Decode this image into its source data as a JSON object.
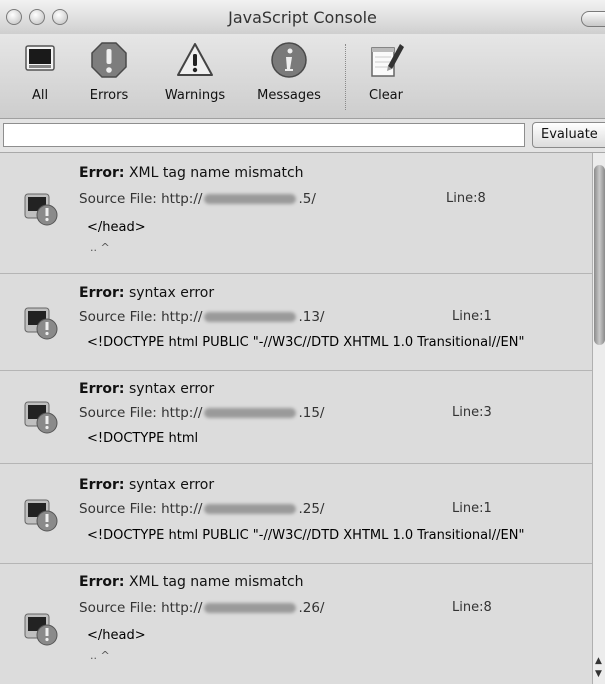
{
  "window": {
    "title": "JavaScript Console"
  },
  "toolbar": {
    "buttons": [
      {
        "label": "All",
        "icon": "all-icon"
      },
      {
        "label": "Errors",
        "icon": "error-octagon-icon"
      },
      {
        "label": "Warnings",
        "icon": "warning-triangle-icon"
      },
      {
        "label": "Messages",
        "icon": "info-circle-icon"
      },
      {
        "label": "Clear",
        "icon": "clear-notepad-icon"
      }
    ]
  },
  "evaluate": {
    "input_value": "",
    "button_label": "Evaluate"
  },
  "entries": [
    {
      "kind": "Error:",
      "message": "XML tag name mismatch",
      "source_label": "Source File:",
      "url_prefix": "http://",
      "url_suffix": ".5/",
      "line": "Line:8",
      "code": "</head>",
      "caret": "..  ^"
    },
    {
      "kind": "Error:",
      "message": "syntax error",
      "source_label": "Source File:",
      "url_prefix": "http://",
      "url_suffix": ".13/",
      "line": "Line:1",
      "code": "<!DOCTYPE html PUBLIC \"-//W3C//DTD XHTML 1.0 Transitional//EN\"",
      "caret": ""
    },
    {
      "kind": "Error:",
      "message": "syntax error",
      "source_label": "Source File:",
      "url_prefix": "http://",
      "url_suffix": ".15/",
      "line": "Line:3",
      "code": "<!DOCTYPE html",
      "caret": ""
    },
    {
      "kind": "Error:",
      "message": "syntax error",
      "source_label": "Source File:",
      "url_prefix": "http://",
      "url_suffix": ".25/",
      "line": "Line:1",
      "code": "<!DOCTYPE html PUBLIC \"-//W3C//DTD XHTML 1.0 Transitional//EN\"",
      "caret": ""
    },
    {
      "kind": "Error:",
      "message": "XML tag name mismatch",
      "source_label": "Source File:",
      "url_prefix": "http://",
      "url_suffix": ".26/",
      "line": "Line:8",
      "code": "</head>",
      "caret": "..  ^"
    }
  ]
}
